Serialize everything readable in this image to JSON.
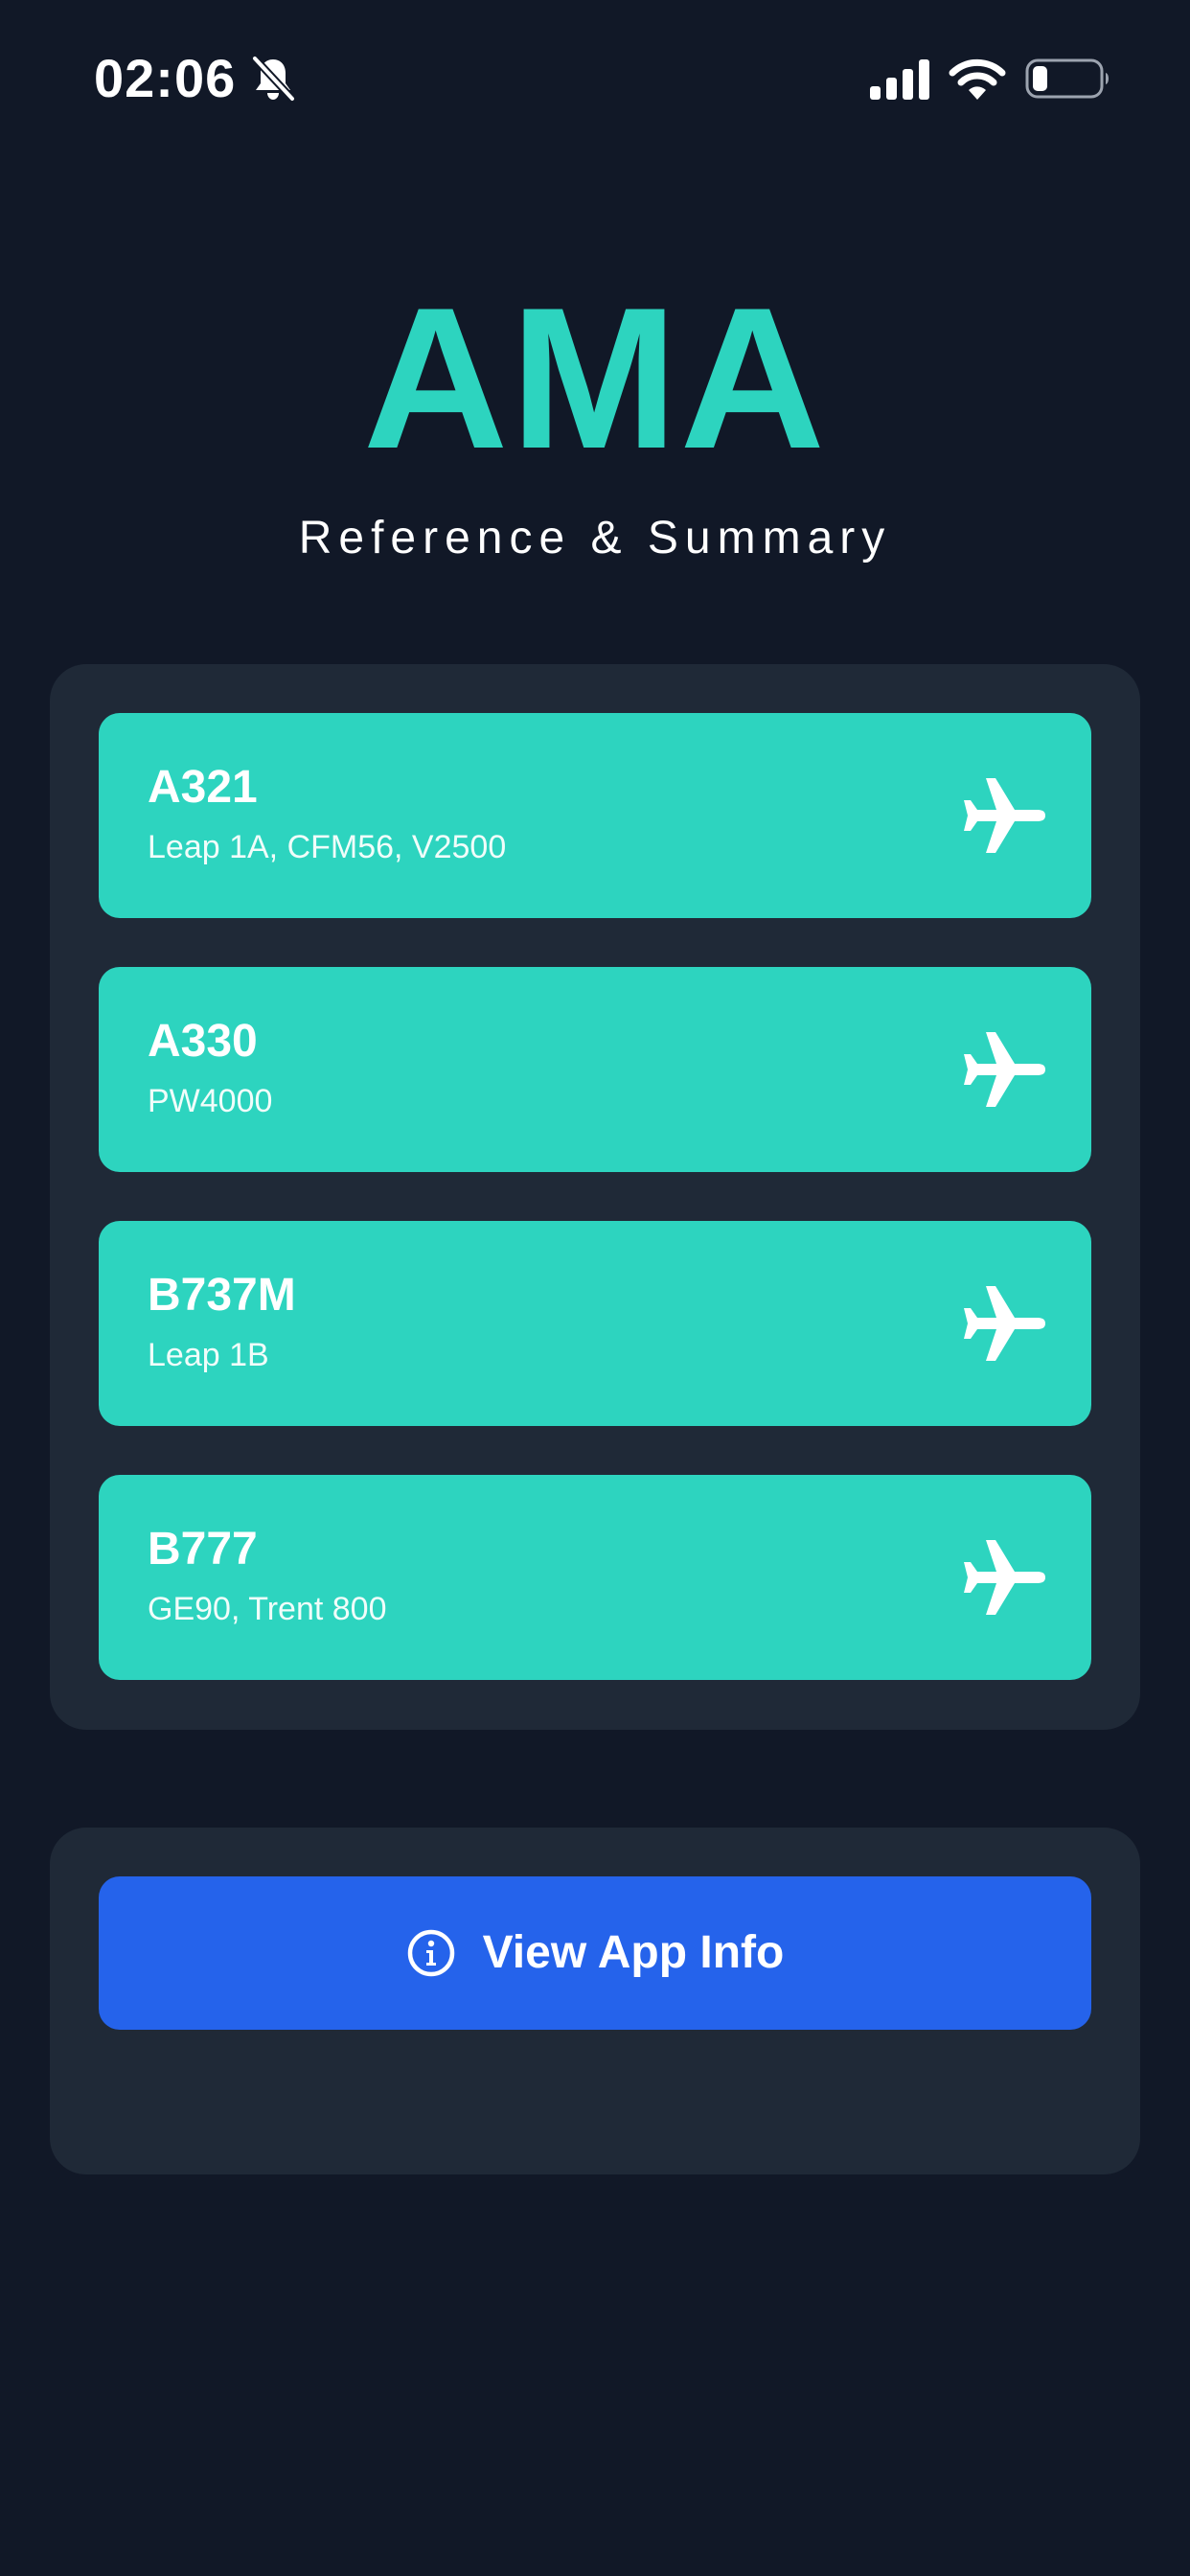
{
  "status_bar": {
    "time": "02:06",
    "icons": [
      "bell-slash-icon",
      "cellular-signal-icon",
      "wifi-icon",
      "battery-icon"
    ]
  },
  "header": {
    "title": "AMA",
    "subtitle": "Reference & Summary"
  },
  "aircraft": [
    {
      "name": "A321",
      "engines": "Leap 1A, CFM56, V2500",
      "icon": "airplane-icon"
    },
    {
      "name": "A330",
      "engines": "PW4000",
      "icon": "airplane-icon"
    },
    {
      "name": "B737M",
      "engines": "Leap 1B",
      "icon": "airplane-icon"
    },
    {
      "name": "B777",
      "engines": "GE90, Trent 800",
      "icon": "airplane-icon"
    }
  ],
  "info_button": {
    "label": "View App Info",
    "icon": "info-circle-icon"
  },
  "colors": {
    "background": "#111827",
    "panel": "#1f2937",
    "accent": "#2dd4bf",
    "button": "#2563eb",
    "text": "#ffffff"
  }
}
